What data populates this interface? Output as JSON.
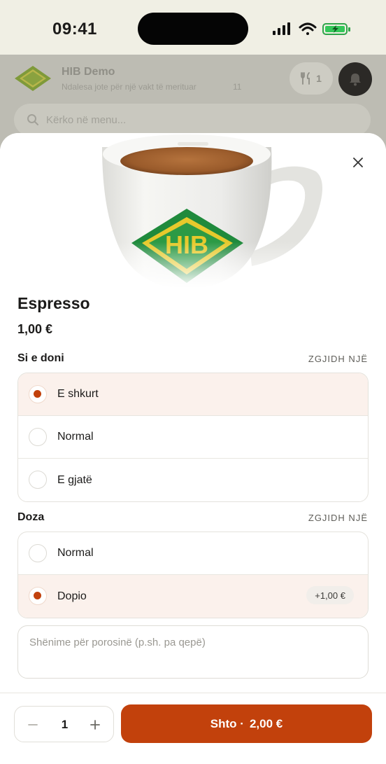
{
  "status_bar": {
    "time": "09:41"
  },
  "header": {
    "title": "HIB Demo",
    "subtitle": "Ndalesa jote për një vakt të merituar",
    "count": "11",
    "cart_count": "1"
  },
  "search": {
    "placeholder": "Kërko në menu..."
  },
  "product": {
    "name": "Espresso",
    "price": "1,00 €"
  },
  "groups": [
    {
      "title": "Si e doni",
      "hint": "ZGJIDH NJË",
      "options": [
        {
          "label": "E shkurt",
          "selected": true
        },
        {
          "label": "Normal",
          "selected": false
        },
        {
          "label": "E gjatë",
          "selected": false
        }
      ]
    },
    {
      "title": "Doza",
      "hint": "ZGJIDH NJË",
      "options": [
        {
          "label": "Normal",
          "selected": false
        },
        {
          "label": "Dopio",
          "selected": true,
          "extra_price": "+1,00 €"
        }
      ]
    }
  ],
  "notes": {
    "placeholder": "Shënime për porosinë (p.sh. pa qepë)"
  },
  "footer": {
    "quantity": "1",
    "add_label": "Shto ·",
    "add_total": "2,00 €"
  },
  "colors": {
    "accent": "#c2410c",
    "selected_bg": "#fbf1ec",
    "status_bar_bg": "#f0efe4"
  },
  "icons": {
    "close": "close-icon",
    "minus": "minus-icon",
    "plus": "plus-icon",
    "search": "search-icon",
    "cart": "utensils-icon",
    "bell": "bell-icon"
  }
}
